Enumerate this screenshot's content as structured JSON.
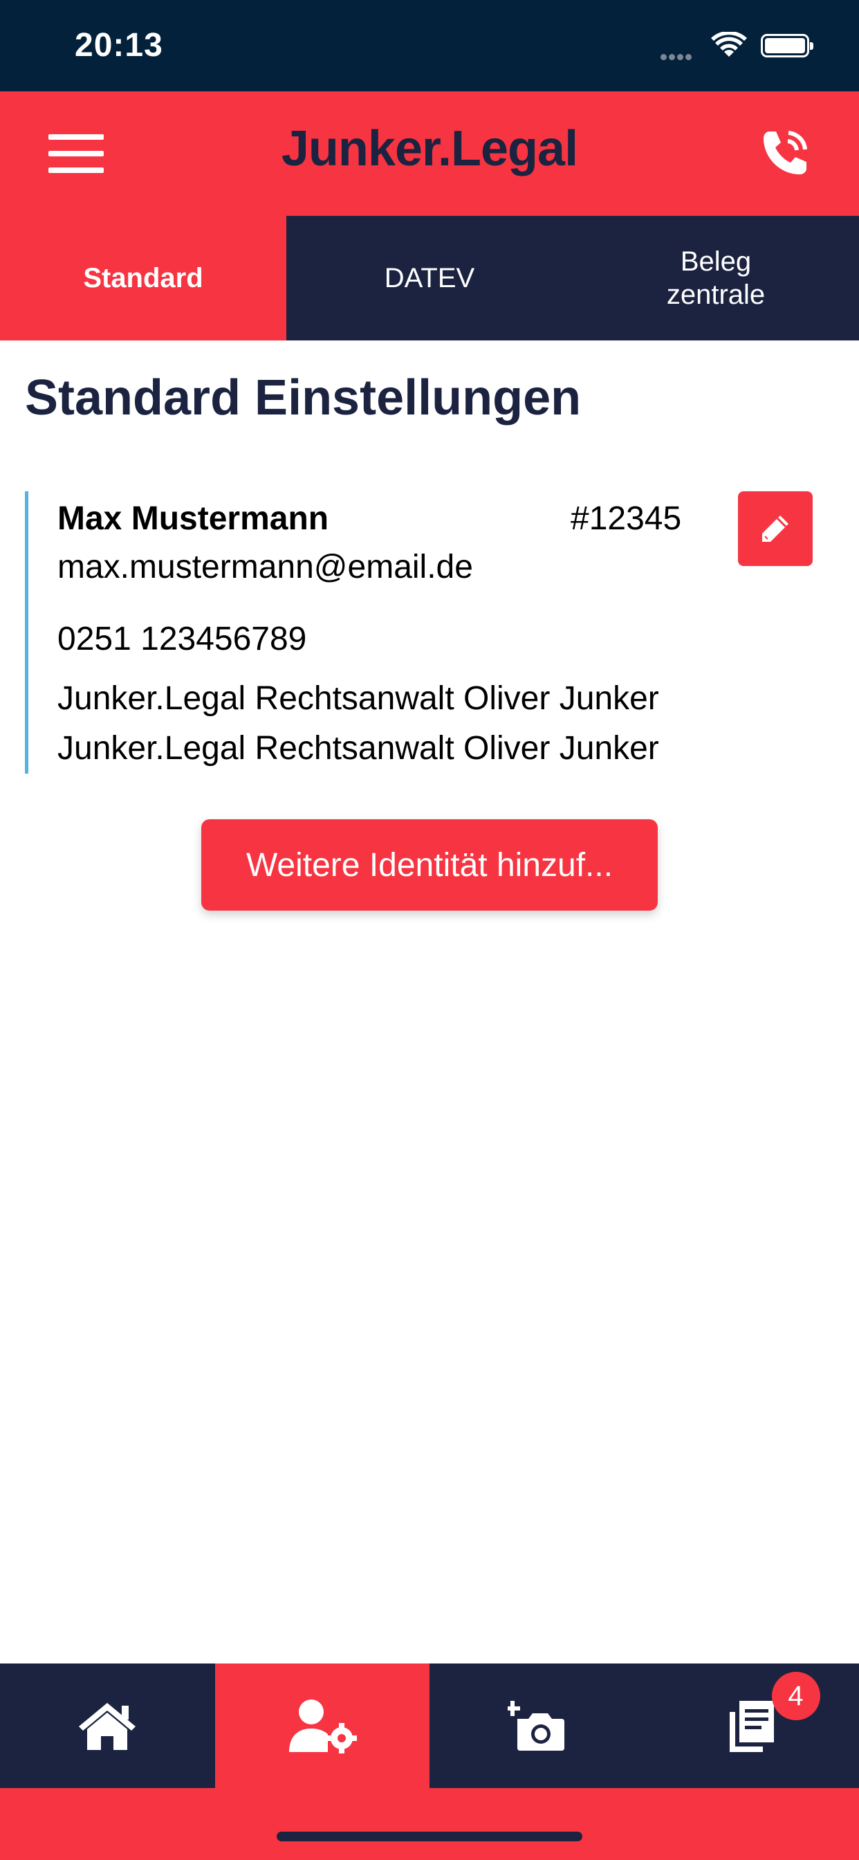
{
  "status_bar": {
    "time": "20:13"
  },
  "app_bar": {
    "logo_text": "Junker.Legal"
  },
  "tabs": [
    {
      "label": "Standard",
      "active": true
    },
    {
      "label": "DATEV",
      "active": false
    },
    {
      "label": "Beleg zentrale",
      "active": false
    }
  ],
  "page": {
    "title": "Standard Einstellungen"
  },
  "identity": {
    "name": "Max Mustermann",
    "id": "#12345",
    "email": "max.mustermann@email.de",
    "phone": "0251 123456789",
    "address_line1": "Junker.Legal Rechtsanwalt Oliver Junker",
    "address_line2": "Junker.Legal Rechtsanwalt Oliver Junker"
  },
  "add_identity_button": "Weitere Identität hinzuf...",
  "bottom_nav": {
    "items": [
      {
        "icon": "home-icon",
        "active": false
      },
      {
        "icon": "user-settings-icon",
        "active": true
      },
      {
        "icon": "add-photo-icon",
        "active": false
      },
      {
        "icon": "documents-icon",
        "active": false,
        "badge": "4"
      }
    ]
  },
  "colors": {
    "accent": "#f73441",
    "navy": "#1b2340",
    "status_bar": "#03213a",
    "card_border": "#53b3e0"
  }
}
